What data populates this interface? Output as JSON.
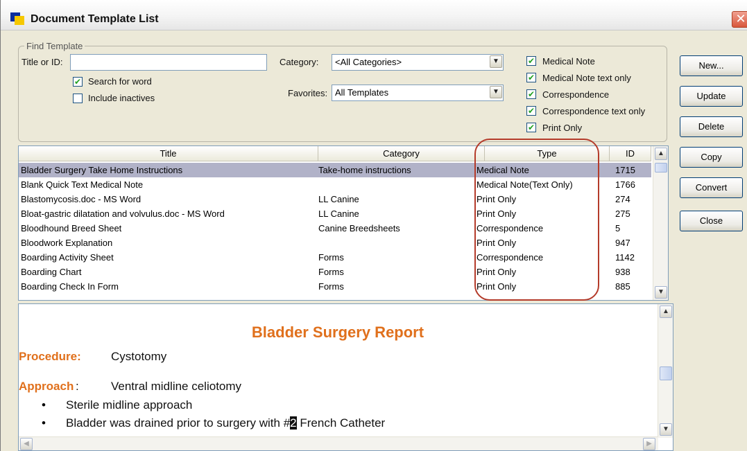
{
  "window": {
    "title": "Document Template List",
    "close_glyph": "✕"
  },
  "find": {
    "group_label": "Find Template",
    "title_label": "Title or ID:",
    "title_value": "",
    "search_word_label": "Search for word",
    "search_word_checked": true,
    "include_inactives_label": "Include inactives",
    "include_inactives_checked": false,
    "category_label": "Category:",
    "category_value": "<All Categories>",
    "favorites_label": "Favorites:",
    "favorites_value": "All Templates"
  },
  "type_filters": [
    {
      "label": "Medical Note",
      "checked": true
    },
    {
      "label": "Medical Note text only",
      "checked": true
    },
    {
      "label": "Correspondence",
      "checked": true
    },
    {
      "label": "Correspondence text only",
      "checked": true
    },
    {
      "label": "Print Only",
      "checked": true
    }
  ],
  "buttons": {
    "new": "New...",
    "update": "Update",
    "delete": "Delete",
    "copy": "Copy",
    "convert": "Convert",
    "close": "Close"
  },
  "table": {
    "columns": [
      "Title",
      "Category",
      "Type",
      "ID"
    ],
    "rows": [
      {
        "title": "Bladder Surgery Take Home Instructions",
        "category": "Take-home instructions",
        "type": "Medical Note",
        "id": "1715",
        "selected": true
      },
      {
        "title": "Blank Quick Text Medical Note",
        "category": "",
        "type": "Medical Note(Text Only)",
        "id": "1766"
      },
      {
        "title": "Blastomycosis.doc - MS Word",
        "category": "LL Canine",
        "type": "Print Only",
        "id": "274"
      },
      {
        "title": "Bloat-gastric dilatation and volvulus.doc - MS Word",
        "category": "LL Canine",
        "type": "Print Only",
        "id": "275"
      },
      {
        "title": "Bloodhound Breed Sheet",
        "category": "Canine Breedsheets",
        "type": "Correspondence",
        "id": "5"
      },
      {
        "title": "Bloodwork Explanation",
        "category": "",
        "type": "Print Only",
        "id": "947"
      },
      {
        "title": "Boarding Activity Sheet",
        "category": "Forms",
        "type": "Correspondence",
        "id": "1142"
      },
      {
        "title": "Boarding Chart",
        "category": "Forms",
        "type": "Print Only",
        "id": "938"
      },
      {
        "title": "Boarding Check In Form",
        "category": "Forms",
        "type": "Print Only",
        "id": "885"
      }
    ]
  },
  "preview": {
    "heading": "Bladder Surgery Report",
    "procedure_label": "Procedure:",
    "procedure_value": "Cystotomy",
    "approach_label": "Approach",
    "approach_colon": ":",
    "approach_value": "Ventral midline celiotomy",
    "bullet_1": "Sterile midline approach",
    "bullet_2_before": "Bladder was drained prior to surgery with #",
    "bullet_2_mark": "2",
    "bullet_2_after": " French Catheter",
    "bullet_glyph": "•"
  },
  "glyphs": {
    "check": "✔",
    "arrow_up": "▲",
    "arrow_down": "▼",
    "arrow_left": "◀",
    "arrow_right": "▶"
  },
  "colors": {
    "accent_orange": "#e0701c",
    "selection": "#b1b2c8",
    "annotation_oval": "#b43b2a"
  }
}
